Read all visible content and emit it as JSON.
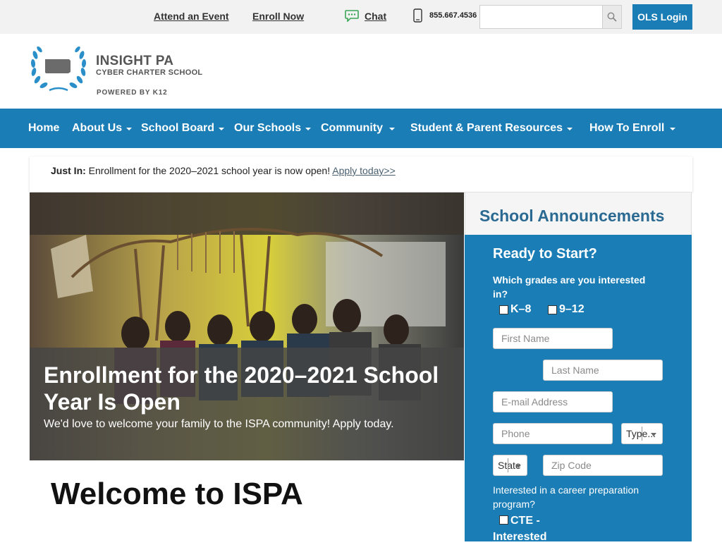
{
  "utility": {
    "links": [
      {
        "label": "Attend an Event"
      },
      {
        "label": "Enroll Now"
      }
    ],
    "chat_label": "Chat",
    "phone": "855.667.4536",
    "search_placeholder": "",
    "ols_login": "OLS Login"
  },
  "logo": {
    "name": "INSIGHT PA",
    "subtitle": "CYBER CHARTER SCHOOL",
    "powered_by": "POWERED BY K12"
  },
  "nav": {
    "items": [
      {
        "label": "Home",
        "dropdown": false
      },
      {
        "label": "About Us",
        "dropdown": true
      },
      {
        "label": "School Board",
        "dropdown": true
      },
      {
        "label": "Our Schools",
        "dropdown": true
      },
      {
        "label": "Community",
        "dropdown": true
      },
      {
        "label": "Student & Parent Resources",
        "dropdown": true
      },
      {
        "label": "How To Enroll",
        "dropdown": true
      }
    ]
  },
  "just_in": {
    "label": "Just In:",
    "text": "Enrollment for the 2020–2021 school year is now open!",
    "link": "Apply today>>"
  },
  "hero": {
    "title": "Enrollment for the 2020–2021 School Year Is Open",
    "subtitle": "We'd love to welcome your family to the ISPA community! Apply today."
  },
  "welcome": "Welcome to ISPA",
  "announcements": {
    "heading": "School Announcements"
  },
  "form": {
    "title": "Ready to Start?",
    "grades_question": "Which grades are you interested in?",
    "grade_options": [
      "K–8",
      "9–12"
    ],
    "first_name_placeholder": "First Name",
    "last_name_placeholder": "Last Name",
    "email_placeholder": "E-mail Address",
    "phone_placeholder": "Phone",
    "phone_type": "Type...",
    "state": "State",
    "zip_placeholder": "Zip Code",
    "career_question": "Interested in a career preparation program?",
    "cte_label": "CTE - Interested"
  },
  "colors": {
    "brand_blue": "#1a7db6",
    "utility_bg": "#f2f2f2",
    "heading_blue": "#2a6a92"
  }
}
